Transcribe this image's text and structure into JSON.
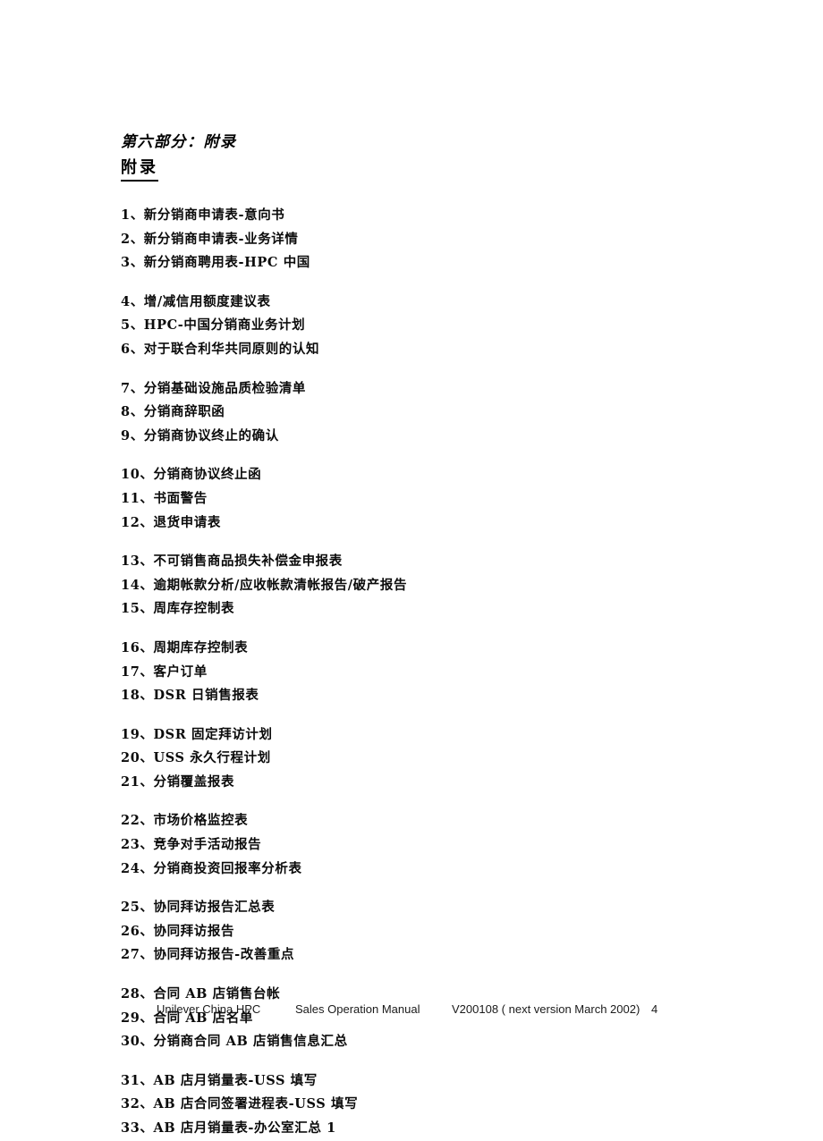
{
  "document": {
    "part_title": "第六部分：附录",
    "section_title": "附录"
  },
  "appendix": {
    "groups": [
      {
        "items": [
          "1、新分销商申请表-意向书",
          "2、新分销商申请表-业务详情",
          "3、新分销商聘用表-HPC 中国"
        ]
      },
      {
        "items": [
          "4、增/减信用额度建议表",
          "5、HPC-中国分销商业务计划",
          "6、对于联合利华共同原则的认知"
        ]
      },
      {
        "items": [
          "7、分销基础设施品质检验清单",
          "8、分销商辞职函",
          "9、分销商协议终止的确认"
        ]
      },
      {
        "items": [
          "10、分销商协议终止函",
          "11、书面警告",
          "12、退货申请表"
        ]
      },
      {
        "items": [
          "13、不可销售商品损失补偿金申报表",
          "14、逾期帐款分析/应收帐款清帐报告/破产报告",
          "15、周库存控制表"
        ]
      },
      {
        "items": [
          "16、周期库存控制表",
          "17、客户订单",
          "18、DSR 日销售报表"
        ]
      },
      {
        "items": [
          "19、DSR 固定拜访计划",
          "20、USS 永久行程计划",
          "21、分销覆盖报表"
        ]
      },
      {
        "items": [
          "22、市场价格监控表",
          "23、竞争对手活动报告",
          "24、分销商投资回报率分析表"
        ]
      },
      {
        "items": [
          "25、协同拜访报告汇总表",
          "26、协同拜访报告",
          "27、协同拜访报告-改善重点"
        ]
      },
      {
        "items": [
          "28、合同 AB 店销售台帐",
          "29、合同 AB 店名单",
          "30、分销商合同 AB 店销售信息汇总"
        ]
      },
      {
        "items": [
          "31、AB 店月销量表-USS 填写",
          "32、AB 店合同签署进程表-USS 填写",
          "33、AB 店月销量表-办公室汇总 1"
        ]
      }
    ]
  },
  "footer": {
    "company": "Unilever China HPC",
    "manual": "Sales Operation Manual",
    "version": "V200108 ( next version March 2002)",
    "page_number": "4"
  }
}
